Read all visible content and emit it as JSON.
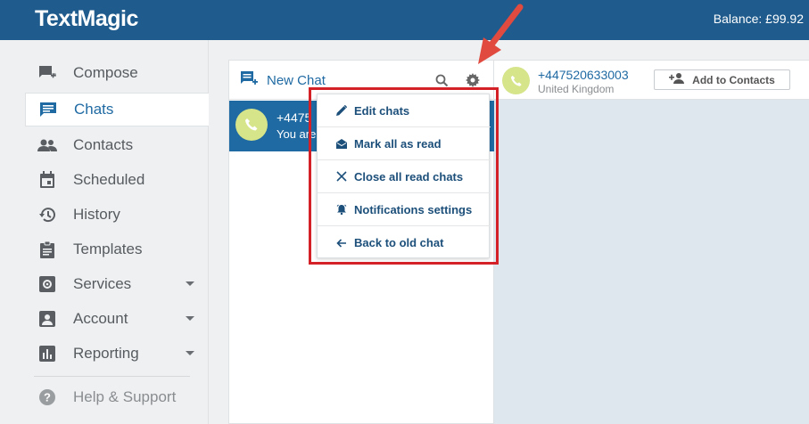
{
  "header": {
    "logo": "TextMagic",
    "balance": "Balance: £99.92"
  },
  "sidebar": {
    "items": [
      {
        "label": "Compose",
        "icon": "compose-icon"
      },
      {
        "label": "Chats",
        "icon": "chat-icon"
      },
      {
        "label": "Contacts",
        "icon": "contacts-icon"
      },
      {
        "label": "Scheduled",
        "icon": "calendar-icon"
      },
      {
        "label": "History",
        "icon": "history-icon"
      },
      {
        "label": "Templates",
        "icon": "clipboard-icon"
      },
      {
        "label": "Services",
        "icon": "services-icon"
      },
      {
        "label": "Account",
        "icon": "account-icon"
      },
      {
        "label": "Reporting",
        "icon": "chart-icon"
      }
    ],
    "help": "Help & Support"
  },
  "chatlist": {
    "new_chat": "New Chat",
    "chats": [
      {
        "number": "+4475",
        "preview": "You are"
      }
    ]
  },
  "conversation": {
    "number": "+447520633003",
    "country": "United Kingdom",
    "add_contact": "Add to Contacts"
  },
  "menu": {
    "items": [
      {
        "label": "Edit chats",
        "icon": "pencil-icon"
      },
      {
        "label": "Mark all as read",
        "icon": "envelope-open-icon"
      },
      {
        "label": "Close all read chats",
        "icon": "close-icon"
      },
      {
        "label": "Notifications settings",
        "icon": "bell-icon"
      },
      {
        "label": "Back to old chat",
        "icon": "arrow-left-icon"
      }
    ]
  },
  "colors": {
    "brand": "#1f5c8d",
    "accent": "#1f6aa3",
    "highlight": "#d42027"
  }
}
